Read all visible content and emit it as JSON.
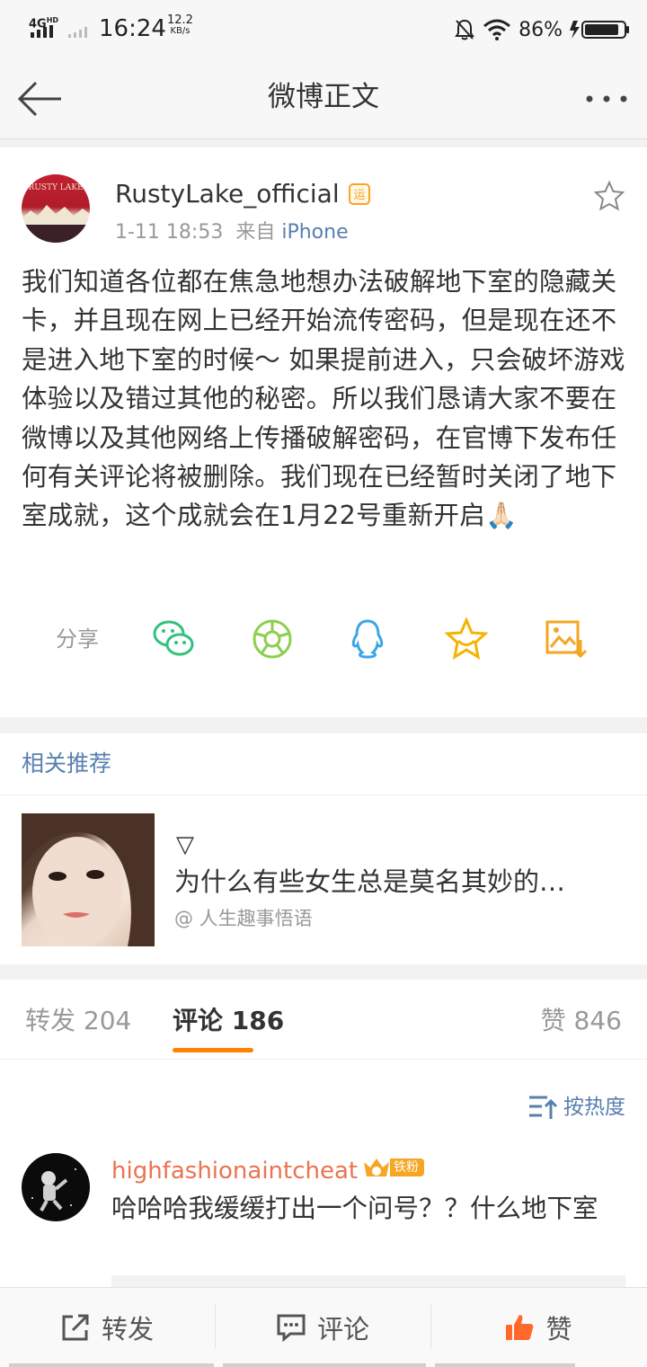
{
  "status_bar": {
    "network": "4G",
    "network_sup": "HD",
    "time": "16:24",
    "speed_value": "12.2",
    "speed_unit": "KB/s",
    "battery": "86%"
  },
  "nav": {
    "title": "微博正文"
  },
  "post": {
    "avatar_text": "RUSTY LAKE",
    "username": "RustyLake_official",
    "vip_badge": "运",
    "time": "1-11 18:53",
    "source_prefix": "来自",
    "source": "iPhone",
    "text": "我们知道各位都在焦急地想办法破解地下室的隐藏关卡，并且现在网上已经开始流传密码，但是现在还不是进入地下室的时候～ 如果提前进入，只会破坏游戏体验以及错过其他的秘密。所以我们恳请大家不要在微博以及其他网络上传播破解密码，在官博下发布任何有关评论将被删除。我们现在已经暂时关闭了地下室成就，这个成就会在1月22号重新开启🙏🏻"
  },
  "share": {
    "label": "分享",
    "icons": [
      "wechat-icon",
      "moments-icon",
      "qq-icon",
      "favorite-star-icon",
      "save-image-icon"
    ]
  },
  "related": {
    "header": "相关推荐",
    "item": {
      "marker": "▽",
      "title": "为什么有些女生总是莫名其妙的…",
      "source": "@ 人生趣事悟语"
    }
  },
  "tabs": {
    "repost_label": "转发 204",
    "comment_label": "评论 186",
    "like_label": "赞 846"
  },
  "comments": {
    "sort_label": "按热度",
    "items": [
      {
        "username": "highfashionaintcheat",
        "badge_level": "6",
        "badge": "铁粉",
        "text": "哈哈哈我缓缓打出一个问号？？什么地下室"
      }
    ]
  },
  "bottom_bar": {
    "repost": "转发",
    "comment": "评论",
    "like": "赞"
  },
  "colors": {
    "accent_orange": "#ff8200",
    "link_blue": "#587fae",
    "username_orange": "#eb7350",
    "wechat_green": "#31c27c",
    "moments_green": "#8ccf4f",
    "qq_blue": "#3aa6e8",
    "star_yellow": "#f6b200",
    "like_orange": "#ff6a2b"
  }
}
